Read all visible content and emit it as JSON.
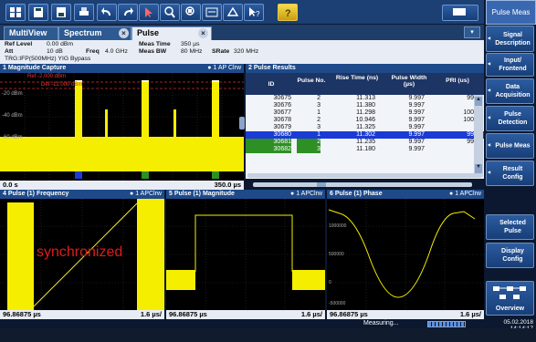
{
  "app": {
    "mode_button": "Pulse Meas"
  },
  "toolbar": {
    "icons": [
      "windows-icon",
      "save-icon",
      "floppy-icon",
      "print-icon",
      "undo-icon",
      "redo-icon",
      "pointer-icon",
      "zoom-icon",
      "multi-zoom-icon",
      "touch-icon",
      "display-icon",
      "help-pointer-icon",
      "help-icon"
    ]
  },
  "tabs": [
    {
      "label": "MultiView"
    },
    {
      "label": "Spectrum"
    },
    {
      "label": "Pulse"
    }
  ],
  "settings": {
    "ref_level_label": "Ref Level",
    "ref_level": "0.00 dBm",
    "att_label": "Att",
    "att": "10 dB",
    "freq_label": "Freq",
    "freq": "4.0 GHz",
    "trg": "TRG:IFP(500MHz) YIG Bypass",
    "meas_time_label": "Meas Time",
    "meas_time": "350 µs",
    "meas_bw_label": "Meas BW",
    "meas_bw": "80 MHz",
    "srate_label": "SRate",
    "srate": "320 MHz"
  },
  "panel1": {
    "title": "1 Magnitude Capture",
    "trace": "1 AP Clrw",
    "ref_label": "Ref -2.000 dBm",
    "det_label": "Det -12.000 dBm",
    "y_ticks": [
      "-20 dBm",
      "-40 dBm",
      "-60 dBm"
    ],
    "x_start": "0.0 s",
    "x_end": "350.0 µs"
  },
  "panel2": {
    "title": "2 Pulse Results",
    "columns": [
      "ID",
      "Pulse No.",
      "Rise Time (ns)",
      "Pulse Width (µs)",
      "PRI (us)"
    ],
    "rows": [
      [
        "30675",
        "2",
        "11.313",
        "9.997",
        "99"
      ],
      [
        "30676",
        "3",
        "11.380",
        "9.997",
        ""
      ],
      [
        "30677",
        "1",
        "11.298",
        "9.997",
        "100"
      ],
      [
        "30678",
        "2",
        "10.946",
        "9.997",
        "100"
      ],
      [
        "30679",
        "3",
        "11.325",
        "9.997",
        ""
      ],
      [
        "30680",
        "1",
        "11.302",
        "9.997",
        "99"
      ],
      [
        "30681",
        "2",
        "11.235",
        "9.997",
        "99"
      ],
      [
        "30682",
        "3",
        "11.180",
        "9.997",
        ""
      ]
    ]
  },
  "panel4": {
    "title": "4 Pulse (1) Frequency",
    "trace": "1 APClrw",
    "annotation": "synchronized",
    "x_start": "96.86875 µs",
    "x_div": "1.6 µs/"
  },
  "panel5": {
    "title": "5 Pulse (1) Magnitude",
    "trace": "1 APClrw",
    "x_start": "96.86875 µs",
    "x_div": "1.6 µs/"
  },
  "panel6": {
    "title": "6 Pulse (1) Phase",
    "trace": "1 APClrw",
    "y_ticks": [
      "1000000",
      "500000",
      "0",
      "-500000"
    ],
    "x_start": "96.86875 µs",
    "x_div": "1.6 µs/"
  },
  "sidebar": [
    {
      "label": "Signal Description"
    },
    {
      "label": "Input/ Frontend"
    },
    {
      "label": "Data Acquisition"
    },
    {
      "label": "Pulse Detection"
    },
    {
      "label": "Pulse Meas"
    },
    {
      "label": "Result Config"
    },
    {
      "label": "Selected Pulse"
    },
    {
      "label": "Display Config"
    },
    {
      "label": "Overview"
    }
  ],
  "status": {
    "measuring": "Measuring...",
    "date": "05.02.2018",
    "time": "14:14:17"
  },
  "colors": {
    "accent": "#1e4a8a",
    "trace": "#f5ee00",
    "selected_row": "#1a3bd6",
    "green_row": "#2e8f25"
  }
}
